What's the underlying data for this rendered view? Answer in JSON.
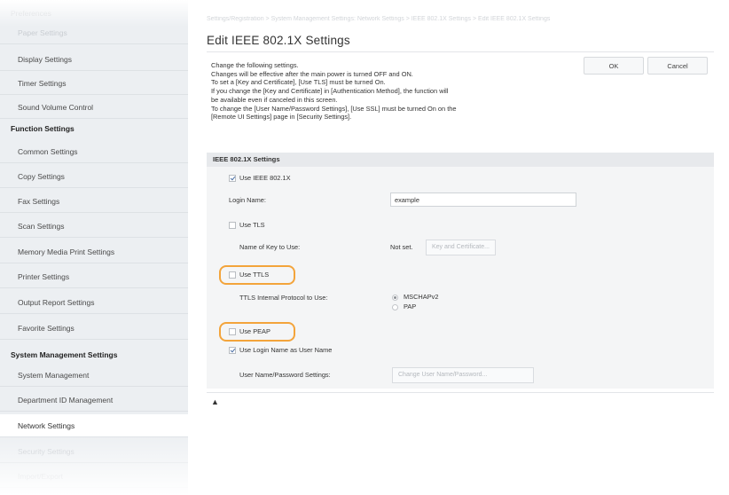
{
  "sidebar": {
    "items": [
      {
        "label": "Preferences",
        "type": "faded"
      },
      {
        "label": "Paper Settings",
        "type": "faded"
      },
      {
        "label": "Display Settings",
        "type": "item"
      },
      {
        "label": "Timer Settings",
        "type": "item"
      },
      {
        "label": "Sound Volume Control",
        "type": "item"
      },
      {
        "label": "Function Settings",
        "type": "header"
      },
      {
        "label": "Common Settings",
        "type": "item"
      },
      {
        "label": "Copy Settings",
        "type": "item"
      },
      {
        "label": "Fax Settings",
        "type": "item"
      },
      {
        "label": "Scan Settings",
        "type": "item"
      },
      {
        "label": "Memory Media Print Settings",
        "type": "item"
      },
      {
        "label": "Printer Settings",
        "type": "item"
      },
      {
        "label": "Output Report Settings",
        "type": "item"
      },
      {
        "label": "Favorite Settings",
        "type": "item"
      },
      {
        "label": "System Management Settings",
        "type": "header"
      },
      {
        "label": "System Management",
        "type": "item"
      },
      {
        "label": "Department ID Management",
        "type": "item"
      },
      {
        "label": "Network Settings",
        "type": "active"
      },
      {
        "label": "Security Settings",
        "type": "faded"
      },
      {
        "label": "Import/Export",
        "type": "faded"
      }
    ]
  },
  "breadcrumb": "Settings/Registration > System Management Settings: Network Settings > IEEE 802.1X Settings > Edit IEEE 802.1X Settings",
  "title": "Edit IEEE 802.1X Settings",
  "description": [
    "Change the following settings.",
    "Changes will be effective after the main power is turned OFF and ON.",
    "To set a [Key and Certificate], [Use TLS] must be turned On.",
    "If you change the [Key and Certificate] in [Authentication Method], the function will",
    "be available even if canceled in this screen.",
    "To change the [User Name/Password Settings], [Use SSL] must be turned On on the",
    "[Remote UI Settings] page in [Security Settings]."
  ],
  "buttons": {
    "ok": "OK",
    "cancel": "Cancel"
  },
  "section": {
    "title": "IEEE 802.1X Settings",
    "use_ieee": {
      "label": "Use IEEE 802.1X",
      "checked": true
    },
    "login_name_label": "Login Name:",
    "login_name_value": "example",
    "use_tls": {
      "label": "Use TLS",
      "checked": false
    },
    "key_label": "Name of Key to Use:",
    "key_value": "Not set.",
    "key_button": "Key and Certificate...",
    "use_ttls": {
      "label": "Use TTLS",
      "checked": false
    },
    "ttls_protocol_label": "TTLS Internal Protocol to Use:",
    "ttls_options": [
      {
        "label": "MSCHAPv2",
        "selected": true
      },
      {
        "label": "PAP",
        "selected": false
      }
    ],
    "use_peap": {
      "label": "Use PEAP",
      "checked": false
    },
    "use_login_as_user": {
      "label": "Use Login Name as User Name",
      "checked": true
    },
    "user_pw_label": "User Name/Password Settings:",
    "user_pw_button": "Change User Name/Password..."
  },
  "back_to_top": "▲",
  "colors": {
    "highlight": "#f3a43b",
    "sidebar_bg": "#eceff2",
    "section_bg": "#f4f5f6"
  }
}
